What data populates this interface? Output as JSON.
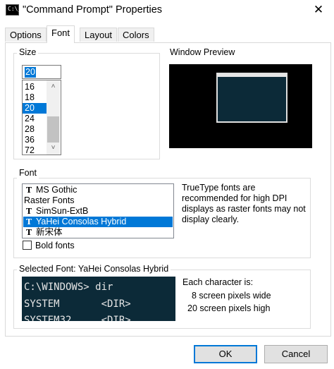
{
  "window": {
    "title": "\"Command Prompt\" Properties",
    "icon": "C:\\_",
    "close": "✕"
  },
  "tabs": [
    {
      "label": "Options",
      "active": false
    },
    {
      "label": "Font",
      "active": true
    },
    {
      "label": "Layout",
      "active": false
    },
    {
      "label": "Colors",
      "active": false
    }
  ],
  "size": {
    "legend": "Size",
    "input_value": "20",
    "items": [
      "16",
      "18",
      "20",
      "24",
      "28",
      "36",
      "72"
    ],
    "selected": "20"
  },
  "preview": {
    "legend": "Window Preview"
  },
  "font": {
    "legend": "Font",
    "items": [
      {
        "label": "MS Gothic",
        "truetype": true,
        "selected": false
      },
      {
        "label": "Raster Fonts",
        "truetype": false,
        "selected": false
      },
      {
        "label": "SimSun-ExtB",
        "truetype": true,
        "selected": false
      },
      {
        "label": "YaHei Consolas Hybrid",
        "truetype": true,
        "selected": true
      },
      {
        "label": "新宋体",
        "truetype": true,
        "selected": false
      }
    ],
    "truetype_note": "TrueType fonts are recommended for high DPI displays as raster fonts may not display clearly.",
    "bold_label": "Bold fonts",
    "bold_checked": false
  },
  "selected_font": {
    "legend": "Selected Font: YaHei Consolas Hybrid",
    "sample_lines": [
      "C:\\WINDOWS> dir",
      "SYSTEM       <DIR>",
      "SYSTEM32     <DIR>"
    ],
    "each_char": "Each character is:",
    "width_text": "8 screen pixels wide",
    "height_text": "20 screen pixels high"
  },
  "buttons": {
    "ok": "OK",
    "cancel": "Cancel"
  },
  "colors": {
    "accent": "#0078d7",
    "console_bg": "#0c2a38"
  }
}
